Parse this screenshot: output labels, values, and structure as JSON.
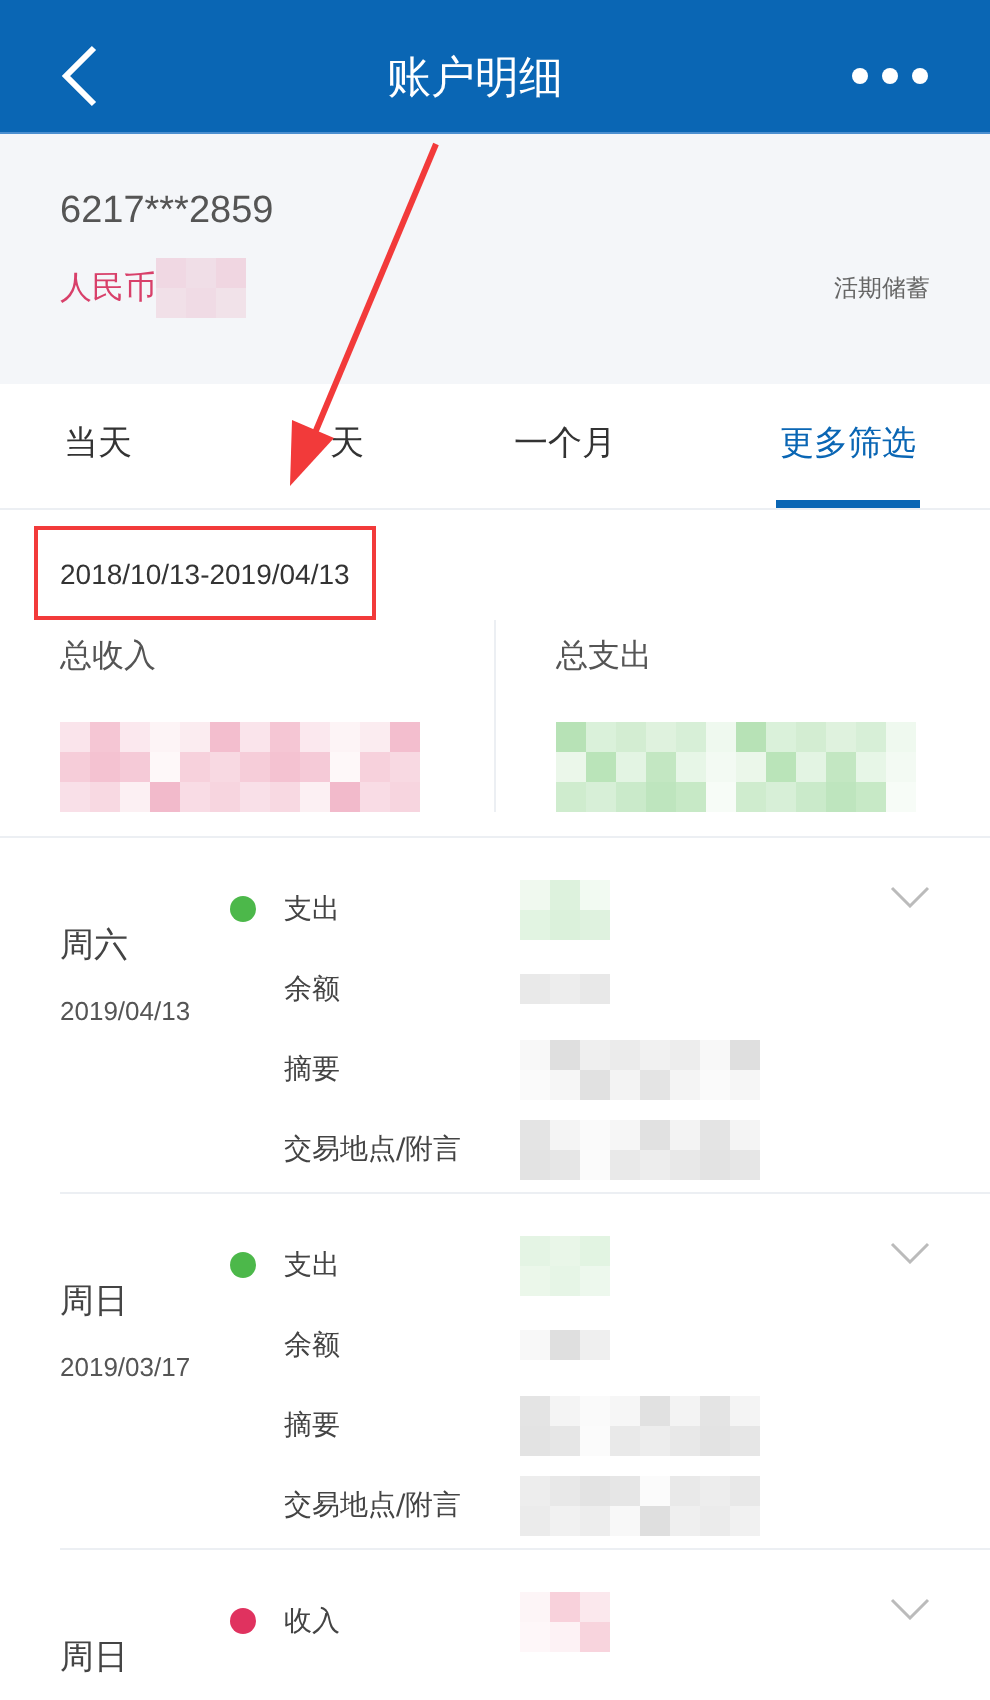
{
  "header": {
    "title": "账户明细"
  },
  "account": {
    "number": "6217***2859",
    "currency": "人民币",
    "type": "活期储蓄"
  },
  "tabs": [
    {
      "label": "当天",
      "selected": false
    },
    {
      "label": "天",
      "selected": false
    },
    {
      "label": "一个月",
      "selected": false
    },
    {
      "label": "更多筛选",
      "selected": true
    }
  ],
  "date_range": "2018/10/13-2019/04/13",
  "summary": [
    {
      "label": "总收入",
      "kind": "income"
    },
    {
      "label": "总支出",
      "kind": "expense"
    }
  ],
  "transactions": [
    {
      "day": "周六",
      "date": "2019/04/13",
      "color": "#4cb84a",
      "fields": [
        "支出",
        "余额",
        "摘要",
        "交易地点/附言"
      ]
    },
    {
      "day": "周日",
      "date": "2019/03/17",
      "color": "#4cb84a",
      "fields": [
        "支出",
        "余额",
        "摘要",
        "交易地点/附言"
      ]
    },
    {
      "day": "周日",
      "color": "#e0325f",
      "fields": [
        "收入"
      ]
    }
  ],
  "annotation": {
    "arrow": true,
    "highlight_box": true
  }
}
